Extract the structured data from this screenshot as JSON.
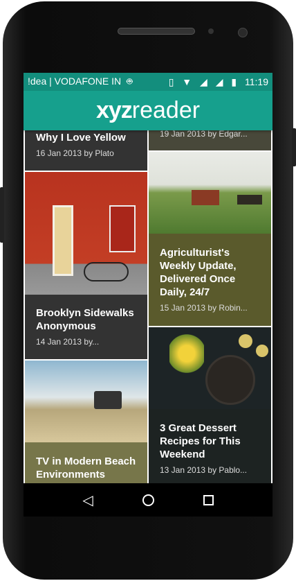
{
  "status_bar": {
    "carrier": "!dea | VODAFONE IN",
    "time": "11:19",
    "icons": [
      "android-icon",
      "vibrate-icon",
      "wifi-icon",
      "signal-icon",
      "roaming-signal-icon",
      "battery-charging-icon"
    ]
  },
  "toolbar": {
    "logo_bold": "xyz",
    "logo_light": "reader"
  },
  "articles": [
    {
      "title": "Why I Love Yellow",
      "meta": "16 Jan 2013 by Plato",
      "color": "#333333"
    },
    {
      "title": "",
      "meta": "19 Jan 2013 by Edgar...",
      "color": "#48483a"
    },
    {
      "title": "Brooklyn Sidewalks Anonymous",
      "meta": "14 Jan 2013 by...",
      "color": "#333333"
    },
    {
      "title": "Agriculturist's Weekly Update, Delivered Once Daily, 24/7",
      "meta": "15 Jan 2013 by Robin...",
      "color": "#5a5a2c"
    },
    {
      "title": "TV in Modern Beach Environments",
      "meta": "",
      "color": "#77764a"
    },
    {
      "title": "3 Great Dessert Recipes for This Weekend",
      "meta": "13 Jan 2013 by Pablo...",
      "color": "#1d2322"
    }
  ],
  "nav": {
    "icons": [
      "back-icon",
      "home-icon",
      "recents-icon"
    ]
  }
}
